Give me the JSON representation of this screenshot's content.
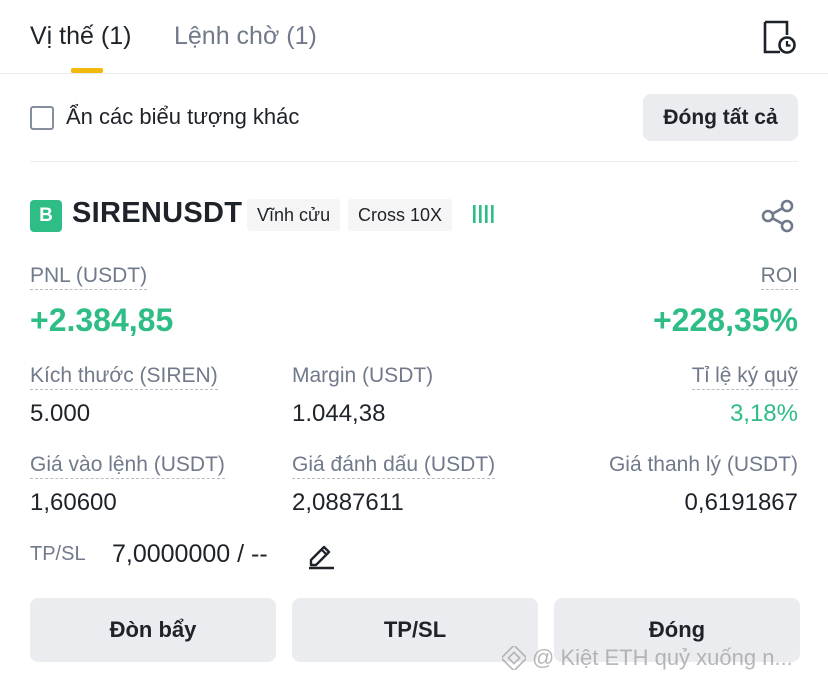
{
  "tabs": [
    {
      "label": "Vị thế (1)",
      "active": true
    },
    {
      "label": "Lệnh chờ (1)",
      "active": false
    }
  ],
  "filter": {
    "hide_other_symbols_label": "Ẩn các biểu tượng khác",
    "checked": false,
    "close_all_label": "Đóng tất cả"
  },
  "position": {
    "side": "B",
    "symbol": "SIRENUSDT",
    "contract_type": "Vĩnh cửu",
    "margin_leverage": "Cross 10X",
    "pnl_label": "PNL (USDT)",
    "pnl_value": "+2.384,85",
    "roi_label": "ROI",
    "roi_value": "+228,35%",
    "size_label": "Kích thước (SIREN)",
    "size_value": "5.000",
    "margin_label": "Margin (USDT)",
    "margin_value": "1.044,38",
    "margin_ratio_label": "Tỉ lệ ký quỹ",
    "margin_ratio_value": "3,18%",
    "entry_label": "Giá vào lệnh (USDT)",
    "entry_value": "1,60600",
    "mark_label": "Giá đánh dấu (USDT)",
    "mark_value": "2,0887611",
    "liq_label": "Giá thanh lý (USDT)",
    "liq_value": "0,6191867",
    "tpsl_label": "TP/SL",
    "tpsl_value": "7,0000000 / --"
  },
  "actions": {
    "leverage_label": "Đòn bẩy",
    "tpsl_label": "TP/SL",
    "close_label": "Đóng"
  },
  "watermark": "@ Kiệt ETH quỷ xuống n...",
  "colors": {
    "accent": "#f0b90b",
    "positive": "#2ebd85",
    "muted": "#707a8a",
    "button_bg": "#eaecef"
  },
  "icons": {
    "history": "order-history-icon",
    "bars": "adl-indicator-icon",
    "share": "share-icon",
    "edit": "pencil-icon"
  }
}
